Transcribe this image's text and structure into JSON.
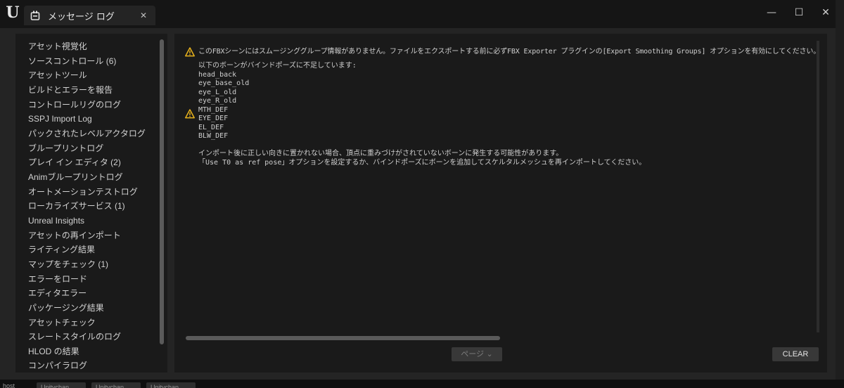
{
  "app": {
    "logo": "U",
    "logo_icon": "unreal-logo-icon"
  },
  "tab": {
    "label": "メッセージ ログ",
    "icon": "message-log-icon",
    "close_glyph": "✕"
  },
  "window_controls": {
    "minimize": "—",
    "maximize": "☐",
    "close": "✕"
  },
  "sidebar": {
    "items": [
      {
        "label": "アセット視覚化"
      },
      {
        "label": "ソースコントロール (6)"
      },
      {
        "label": "アセットツール"
      },
      {
        "label": "ビルドとエラーを報告"
      },
      {
        "label": "コントロールリグのログ"
      },
      {
        "label": "SSPJ Import Log"
      },
      {
        "label": "パックされたレベルアクタログ"
      },
      {
        "label": "ブループリントログ"
      },
      {
        "label": "プレイ イン エディタ (2)"
      },
      {
        "label": "Animブループリントログ"
      },
      {
        "label": "オートメーションテストログ"
      },
      {
        "label": "ローカライズサービス (1)"
      },
      {
        "label": "Unreal Insights"
      },
      {
        "label": "アセットの再インポート"
      },
      {
        "label": "ライティング結果"
      },
      {
        "label": "マップをチェック (1)"
      },
      {
        "label": "エラーをロード"
      },
      {
        "label": "エディタエラー"
      },
      {
        "label": "パッケージング結果"
      },
      {
        "label": "アセットチェック"
      },
      {
        "label": "スレートスタイルのログ"
      },
      {
        "label": "HLOD の結果"
      },
      {
        "label": "コンパイラログ"
      }
    ]
  },
  "log": {
    "lines": [
      {
        "text": "このFBXシーンにはスムージンググループ情報がありません。ファイルをエクスポートする前に必ずFBX Exporter プラグインの[Export Smoothing Groups] オプションを有効にしてください。"
      },
      {
        "text": "以下のボーンがバインドポーズに不足しています:"
      },
      {
        "text": "head_back"
      },
      {
        "text": "eye_base_old"
      },
      {
        "text": "eye_L_old"
      },
      {
        "text": "eye_R_old"
      },
      {
        "text": "MTH_DEF"
      },
      {
        "text": "EYE_DEF"
      },
      {
        "text": "EL_DEF"
      },
      {
        "text": "BLW_DEF"
      },
      {
        "text": ""
      },
      {
        "text": "インポート後に正しい向きに置かれない場合、頂点に重みづけがされていないボーンに発生する可能性があります。"
      },
      {
        "text": "「Use T0 as ref pose」オプションを設定するか、バインドポーズにボーンを追加してスケルタルメッシュを再インポートしてください。"
      }
    ],
    "warning_icon": "warning-triangle-icon",
    "warning_color": "#e8b21c"
  },
  "footer": {
    "page_label": "ページ ⌄",
    "clear_label": "CLEAR"
  },
  "taskbar": {
    "host": "host",
    "tabs": [
      "Unitychan",
      "Unitychan",
      "Unitychan"
    ]
  }
}
